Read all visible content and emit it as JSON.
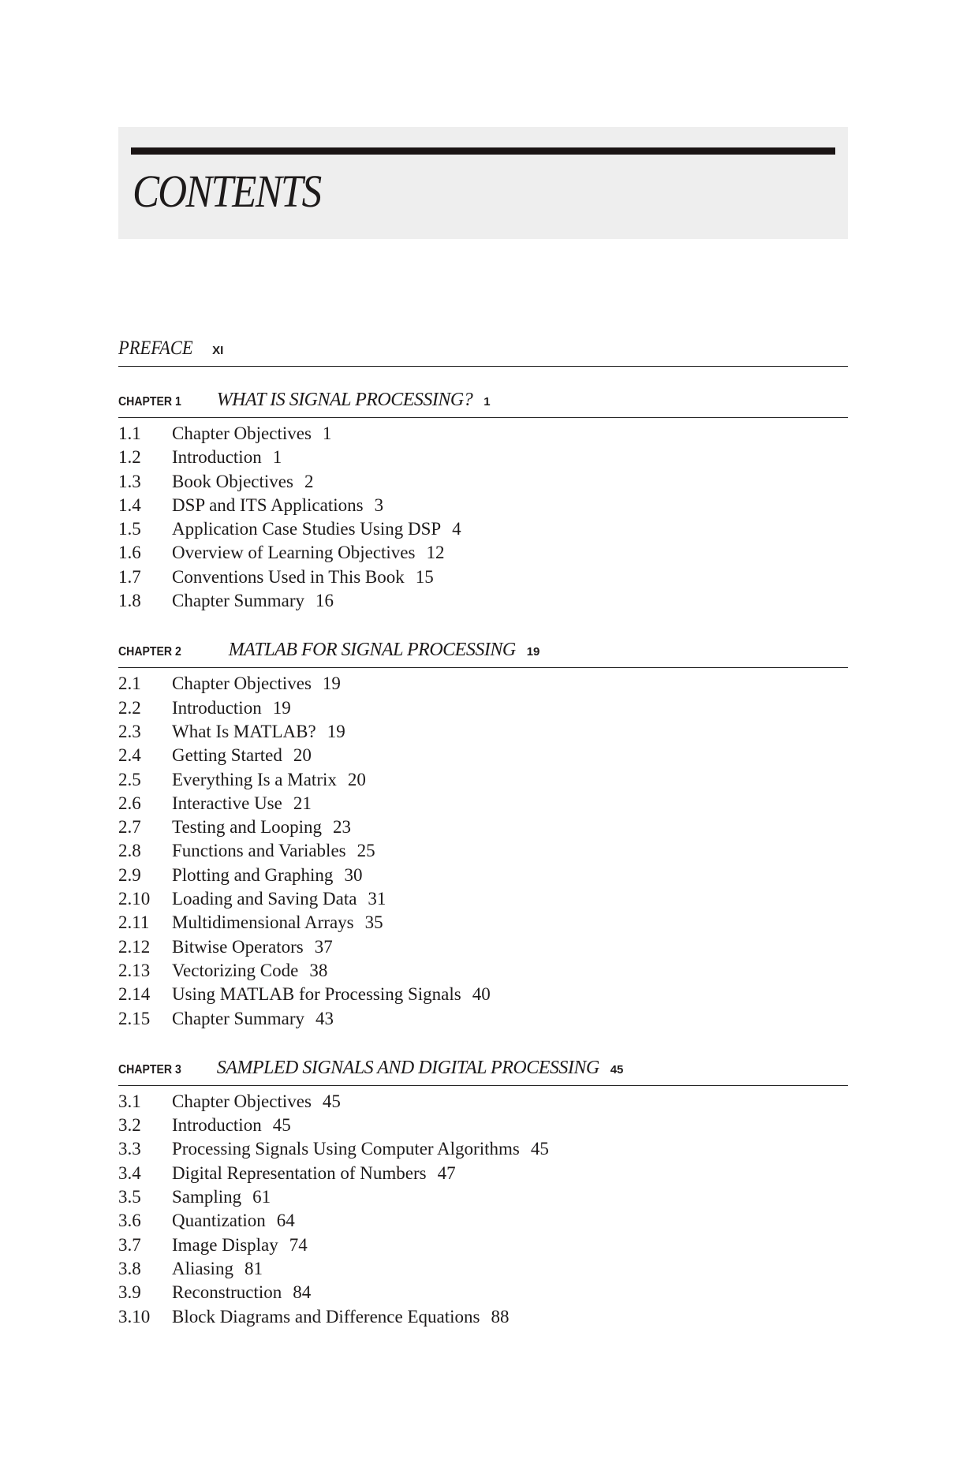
{
  "page": {
    "title": "CONTENTS",
    "preface": {
      "label": "PREFACE",
      "page": "XI"
    },
    "chapters": [
      {
        "label": "CHAPTER 1",
        "title": "WHAT IS SIGNAL PROCESSING?",
        "page": "1",
        "entries": [
          {
            "num": "1.1",
            "title": "Chapter Objectives",
            "page": "1"
          },
          {
            "num": "1.2",
            "title": "Introduction",
            "page": "1"
          },
          {
            "num": "1.3",
            "title": "Book Objectives",
            "page": "2"
          },
          {
            "num": "1.4",
            "title": "DSP and ITS Applications",
            "page": "3"
          },
          {
            "num": "1.5",
            "title": "Application Case Studies Using DSP",
            "page": "4"
          },
          {
            "num": "1.6",
            "title": "Overview of Learning Objectives",
            "page": "12"
          },
          {
            "num": "1.7",
            "title": "Conventions Used in This Book",
            "page": "15"
          },
          {
            "num": "1.8",
            "title": "Chapter Summary",
            "page": "16"
          }
        ]
      },
      {
        "label": "CHAPTER 2",
        "title": "MATLAB FOR SIGNAL PROCESSING",
        "page": "19",
        "entries": [
          {
            "num": "2.1",
            "title": "Chapter Objectives",
            "page": "19"
          },
          {
            "num": "2.2",
            "title": "Introduction",
            "page": "19"
          },
          {
            "num": "2.3",
            "title": "What Is MATLAB?",
            "page": "19"
          },
          {
            "num": "2.4",
            "title": "Getting Started",
            "page": "20"
          },
          {
            "num": "2.5",
            "title": "Everything Is a Matrix",
            "page": "20"
          },
          {
            "num": "2.6",
            "title": "Interactive Use",
            "page": "21"
          },
          {
            "num": "2.7",
            "title": "Testing and Looping",
            "page": "23"
          },
          {
            "num": "2.8",
            "title": "Functions and Variables",
            "page": "25"
          },
          {
            "num": "2.9",
            "title": "Plotting and Graphing",
            "page": "30"
          },
          {
            "num": "2.10",
            "title": "Loading and Saving Data",
            "page": "31"
          },
          {
            "num": "2.11",
            "title": "Multidimensional Arrays",
            "page": "35"
          },
          {
            "num": "2.12",
            "title": "Bitwise Operators",
            "page": "37"
          },
          {
            "num": "2.13",
            "title": "Vectorizing Code",
            "page": "38"
          },
          {
            "num": "2.14",
            "title": "Using MATLAB for Processing Signals",
            "page": "40"
          },
          {
            "num": "2.15",
            "title": "Chapter Summary",
            "page": "43"
          }
        ]
      },
      {
        "label": "CHAPTER 3",
        "title": "SAMPLED SIGNALS AND DIGITAL PROCESSING",
        "page": "45",
        "entries": [
          {
            "num": "3.1",
            "title": "Chapter Objectives",
            "page": "45"
          },
          {
            "num": "3.2",
            "title": "Introduction",
            "page": "45"
          },
          {
            "num": "3.3",
            "title": "Processing Signals Using Computer Algorithms",
            "page": "45"
          },
          {
            "num": "3.4",
            "title": "Digital Representation of Numbers",
            "page": "47"
          },
          {
            "num": "3.5",
            "title": "Sampling",
            "page": "61"
          },
          {
            "num": "3.6",
            "title": "Quantization",
            "page": "64"
          },
          {
            "num": "3.7",
            "title": "Image Display",
            "page": "74"
          },
          {
            "num": "3.8",
            "title": "Aliasing",
            "page": "81"
          },
          {
            "num": "3.9",
            "title": "Reconstruction",
            "page": "84"
          },
          {
            "num": "3.10",
            "title": "Block Diagrams and Difference Equations",
            "page": "88"
          }
        ]
      }
    ]
  }
}
